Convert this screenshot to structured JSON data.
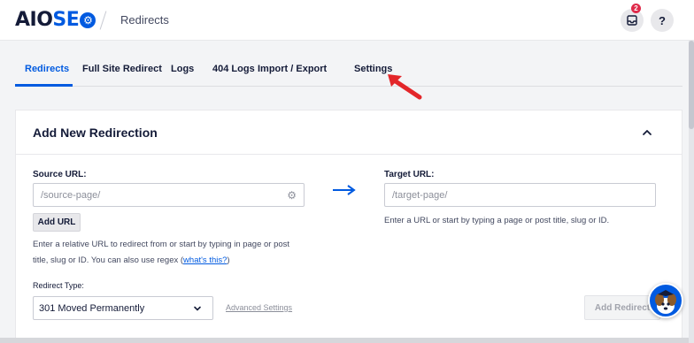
{
  "header": {
    "logo_prefix": "AIO",
    "logo_suffix": "SE",
    "logo_gear": "⚙",
    "breadcrumb": "Redirects",
    "notification_count": "2",
    "help_label": "?"
  },
  "tabs": [
    {
      "label": "Redirects",
      "active": true
    },
    {
      "label": "Full Site Redirect",
      "active": false
    },
    {
      "label": "Logs",
      "active": false
    },
    {
      "label": "404 Logs",
      "active": false
    },
    {
      "label": "Import / Export",
      "active": false
    },
    {
      "label": "Settings",
      "active": false
    }
  ],
  "card": {
    "title": "Add New Redirection",
    "source": {
      "label": "Source URL:",
      "placeholder": "/source-page/",
      "add_url_label": "Add URL",
      "help_line1": "Enter a relative URL to redirect from or start by typing in page or post",
      "help_line2_prefix": "title, slug or ID. You can also use regex (",
      "help_link": "what's this?",
      "help_line2_suffix": ")"
    },
    "target": {
      "label": "Target URL:",
      "placeholder": "/target-page/",
      "help": "Enter a URL or start by typing a page or post title, slug or ID."
    },
    "redirect_type": {
      "label": "Redirect Type:",
      "selected": "301 Moved Permanently"
    },
    "advanced_settings_label": "Advanced Settings",
    "add_redirect_label": "Add Redirect"
  },
  "colors": {
    "brand_blue": "#005ae0",
    "annotation_red": "#e3262a",
    "badge_red": "#df2a4a"
  }
}
